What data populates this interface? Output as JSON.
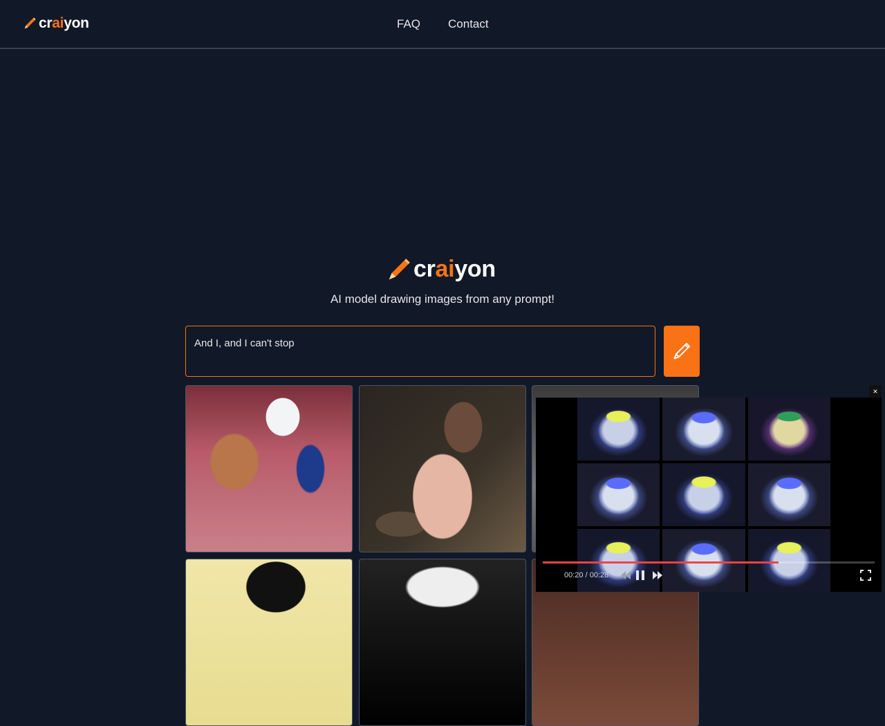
{
  "header": {
    "logo": {
      "pre": "cr",
      "ai": "ai",
      "post": "yon"
    },
    "nav": [
      {
        "label": "FAQ"
      },
      {
        "label": "Contact"
      }
    ]
  },
  "hero": {
    "logo": {
      "pre": "cr",
      "ai": "ai",
      "post": "yon"
    },
    "tagline": "AI model drawing images from any prompt!"
  },
  "prompt": {
    "value": "And I, and I can't stop",
    "draw_button_icon": "pencil-icon"
  },
  "colors": {
    "background": "#111827",
    "accent": "#f97316",
    "text": "#e5e7eb"
  },
  "results": {
    "tile_count": 9
  },
  "video": {
    "current_time": "00:20",
    "separator": "/",
    "duration": "00:28",
    "progress": 0.71,
    "close_label": "×"
  }
}
